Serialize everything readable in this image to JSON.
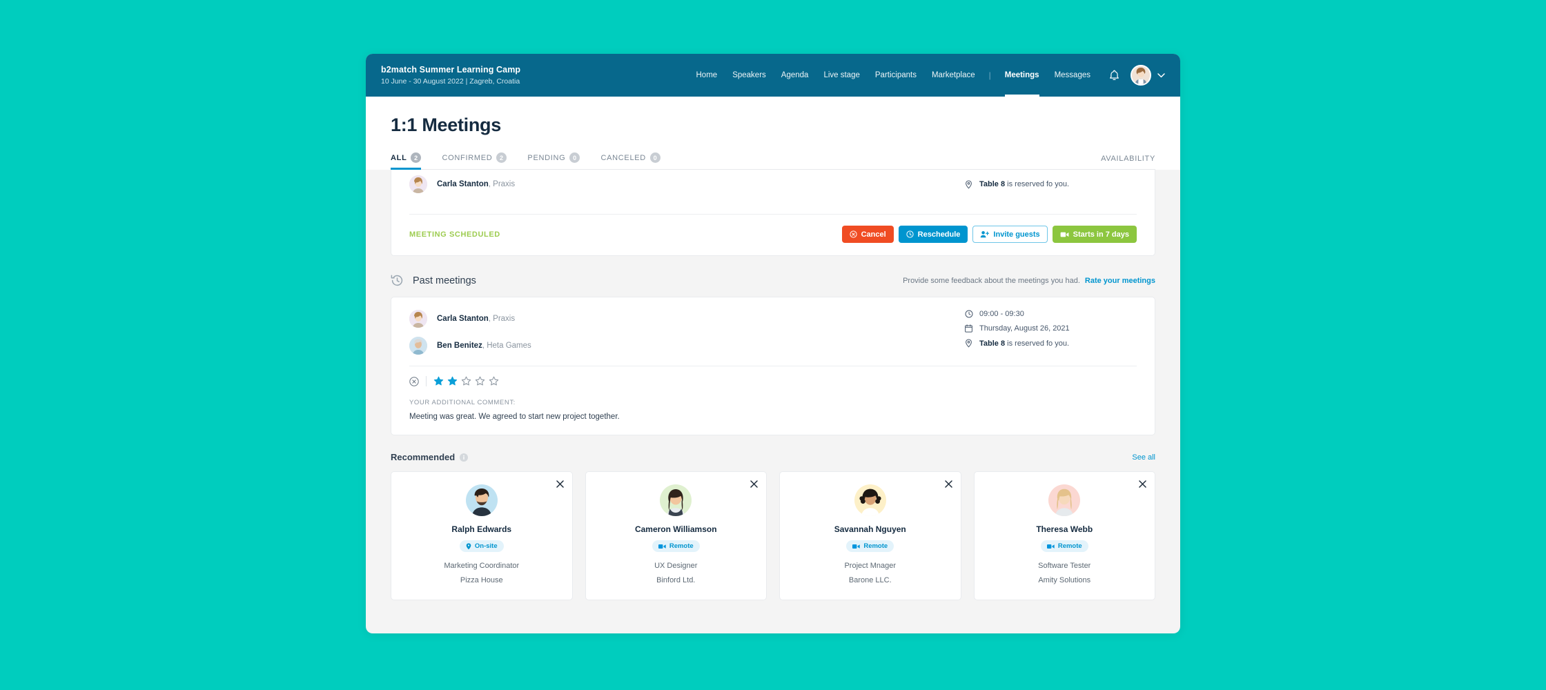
{
  "header": {
    "brand_title": "b2match Summer Learning Camp",
    "brand_subtitle": "10 June - 30 August 2022 | Zagreb, Croatia",
    "nav": [
      {
        "label": "Home",
        "active": false
      },
      {
        "label": "Speakers",
        "active": false
      },
      {
        "label": "Agenda",
        "active": false
      },
      {
        "label": "Live stage",
        "active": false
      },
      {
        "label": "Participants",
        "active": false
      },
      {
        "label": "Marketplace",
        "active": false
      },
      {
        "label": "Meetings",
        "active": true
      },
      {
        "label": "Messages",
        "active": false
      }
    ],
    "separator": "|",
    "bell_icon": "bell-icon",
    "avatar_icon": "user-avatar",
    "chevron_icon": "chevron-down-icon"
  },
  "page": {
    "title": "1:1 Meetings",
    "availability_label": "AVAILABILITY"
  },
  "tabs": [
    {
      "label": "ALL",
      "count": "2",
      "active": true
    },
    {
      "label": "CONFIRMED",
      "count": "2",
      "active": false
    },
    {
      "label": "PENDING",
      "count": "0",
      "active": false
    },
    {
      "label": "CANCELED",
      "count": "0",
      "active": false
    }
  ],
  "upcoming_meeting": {
    "person": {
      "name": "Carla Stanton",
      "org": ", Praxis"
    },
    "location_bold": "Table 8",
    "location_rest": " is reserved fo you.",
    "status": "MEETING SCHEDULED",
    "buttons": {
      "cancel": "Cancel",
      "reschedule": "Reschedule",
      "invite": "Invite guests",
      "starts": "Starts in 7 days"
    }
  },
  "past_section": {
    "title": "Past meetings",
    "note": "Provide some feedback about the meetings you had.",
    "link": "Rate your meetings",
    "history_icon": "history-icon"
  },
  "past_meeting": {
    "people": [
      {
        "name": "Carla Stanton",
        "org": ", Praxis"
      },
      {
        "name": "Ben Benitez",
        "org": ", Heta Games"
      }
    ],
    "time": "09:00 - 09:30",
    "date": "Thursday, August 26, 2021",
    "location_bold": "Table 8",
    "location_rest": " is reserved fo you.",
    "rating": 2,
    "rating_max": 5,
    "comment_label": "YOUR ADDITIONAL COMMENT:",
    "comment_text": "Meeting was great. We agreed to start new project together."
  },
  "recommended": {
    "title": "Recommended",
    "info_icon": "info-icon",
    "see_all": "See all",
    "cards": [
      {
        "name": "Ralph Edwards",
        "mode": "On-site",
        "mode_icon": "location-pin-icon",
        "role": "Marketing Coordinator",
        "org": "Pizza House",
        "avatar_bg": "#bfe2f2",
        "close_icon": "close-icon"
      },
      {
        "name": "Cameron Williamson",
        "mode": "Remote",
        "mode_icon": "video-camera-icon",
        "role": "UX Designer",
        "org": "Binford Ltd.",
        "avatar_bg": "#dff0cf",
        "close_icon": "close-icon"
      },
      {
        "name": "Savannah Nguyen",
        "mode": "Remote",
        "mode_icon": "video-camera-icon",
        "role": "Project Mnager",
        "org": "Barone LLC.",
        "avatar_bg": "#fdf0c8",
        "close_icon": "close-icon"
      },
      {
        "name": "Theresa Webb",
        "mode": "Remote",
        "mode_icon": "video-camera-icon",
        "role": "Software Tester",
        "org": "Amity Solutions",
        "avatar_bg": "#fbd8d2",
        "close_icon": "close-icon"
      }
    ]
  },
  "colors": {
    "page_background": "#00cdbe",
    "header_bar": "#07688c",
    "accent_blue": "#0095cf",
    "danger_red": "#f04c23",
    "success_green": "#8cc63f",
    "status_green": "#9dcc50"
  }
}
